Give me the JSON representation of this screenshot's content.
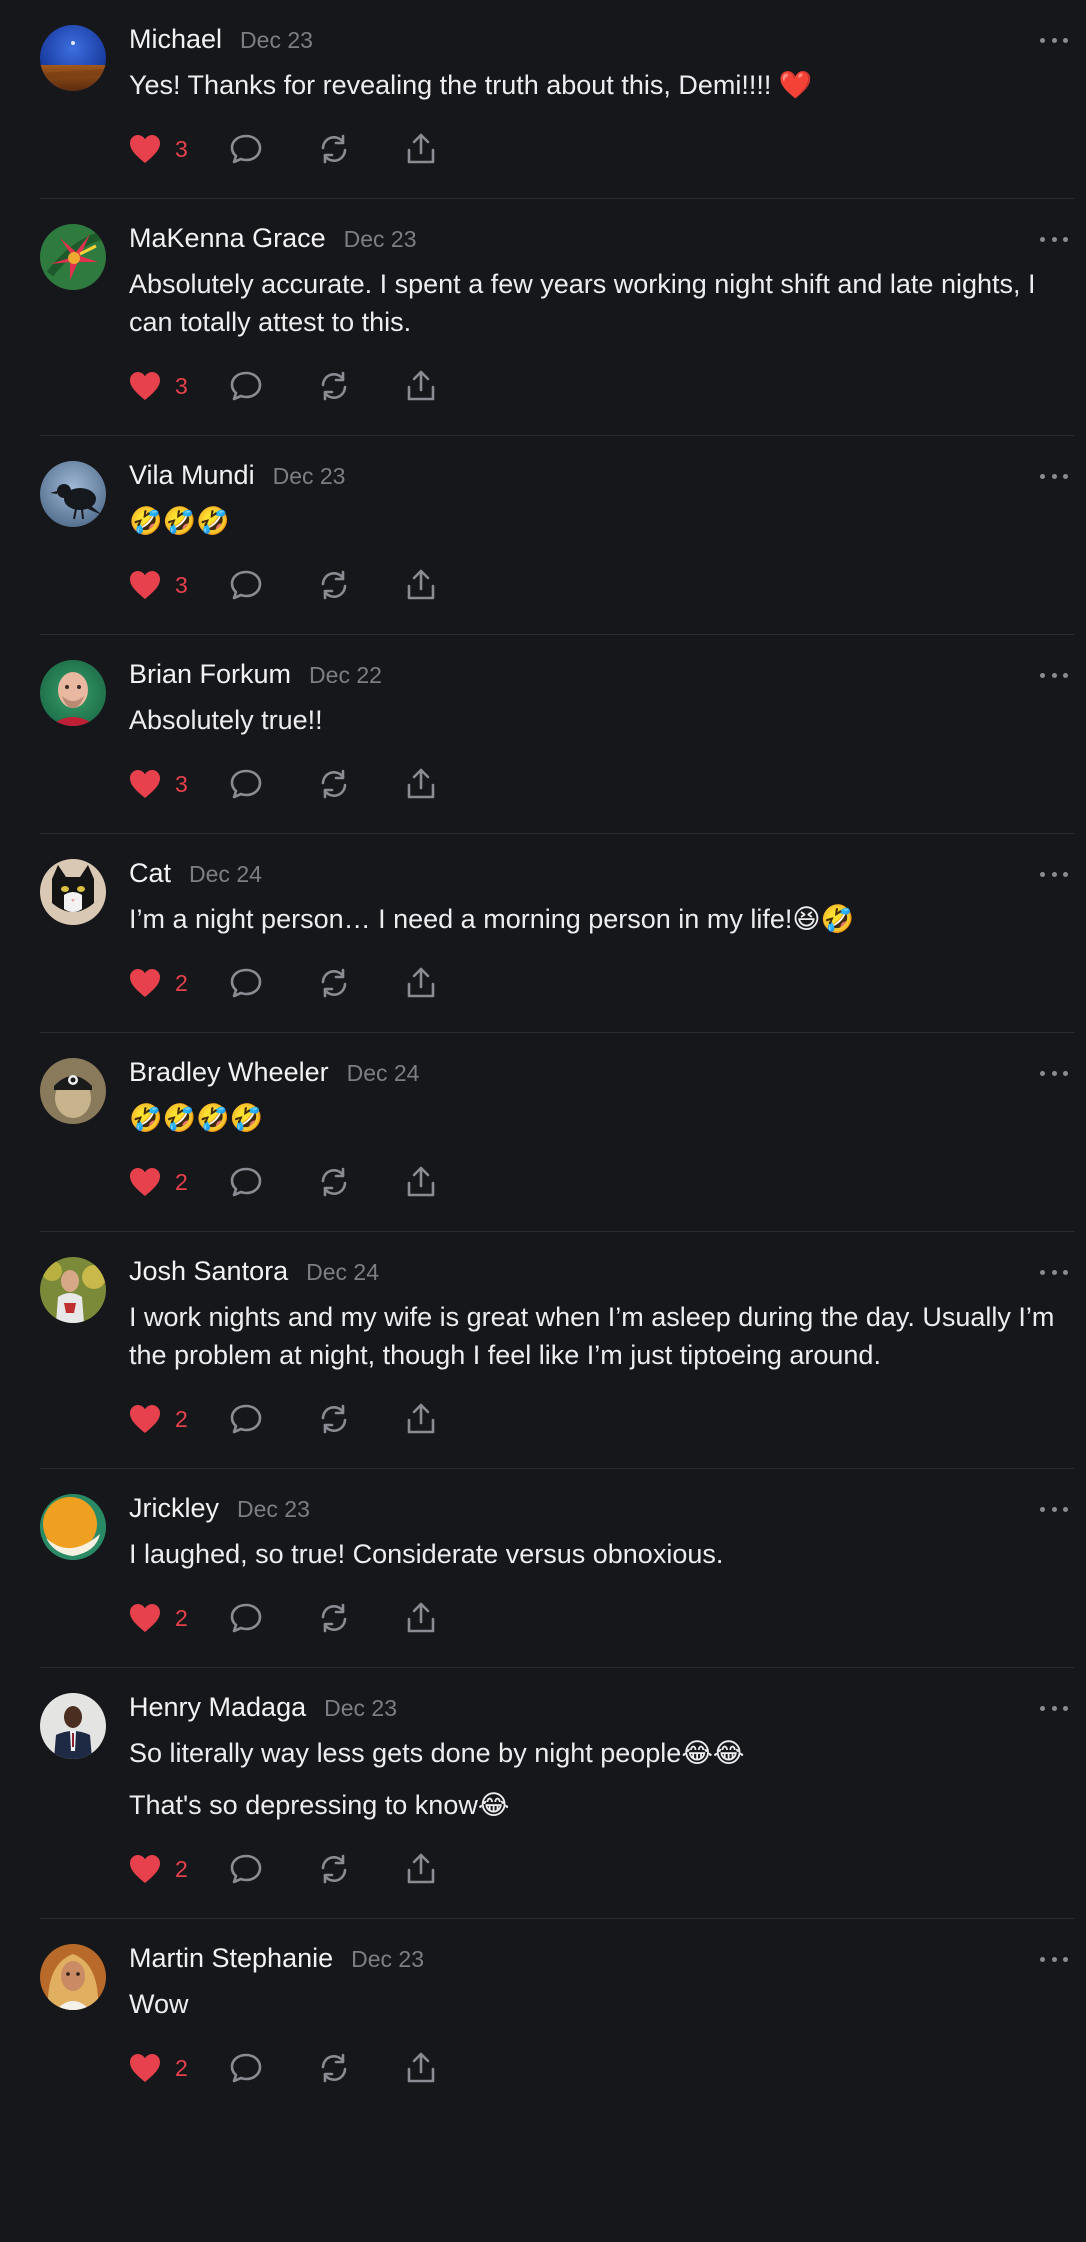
{
  "comments": [
    {
      "author": "Michael",
      "date": "Dec 23",
      "lines": [
        "Yes! Thanks for revealing the truth about this, Demi!!!! ❤️"
      ],
      "likes": "3",
      "avatar": "blue-sky-landscape"
    },
    {
      "author": "MaKenna Grace",
      "date": "Dec 23",
      "lines": [
        "Absolutely accurate. I spent a few years working night shift and late nights, I can totally attest to this."
      ],
      "likes": "3",
      "avatar": "tropical-flower"
    },
    {
      "author": "Vila Mundi",
      "date": "Dec 23",
      "lines": [
        "🤣🤣🤣"
      ],
      "likes": "3",
      "avatar": "crow-sky"
    },
    {
      "author": "Brian Forkum",
      "date": "Dec 22",
      "lines": [
        "Absolutely true!!"
      ],
      "likes": "3",
      "avatar": "man-portrait-green"
    },
    {
      "author": "Cat",
      "date": "Dec 24",
      "lines": [
        "I’m a night person… I need a morning person in my life!😆🤣"
      ],
      "likes": "2",
      "avatar": "black-white-cat"
    },
    {
      "author": "Bradley Wheeler",
      "date": "Dec 24",
      "lines": [
        "🤣🤣🤣🤣"
      ],
      "likes": "2",
      "avatar": "person-in-cap"
    },
    {
      "author": "Josh Santora",
      "date": "Dec 24",
      "lines": [
        "I work nights and my wife is great when I’m asleep during the day. Usually I’m the problem at night, though I feel like I’m just tiptoeing around."
      ],
      "likes": "2",
      "avatar": "person-outdoors"
    },
    {
      "author": "Jrickley",
      "date": "Dec 23",
      "lines": [
        "I laughed, so true! Considerate versus obnoxious."
      ],
      "likes": "2",
      "avatar": "orange-circle-logo"
    },
    {
      "author": "Henry Madaga",
      "date": "Dec 23",
      "lines": [
        "So literally way less gets done by night people😂😂",
        "That's so depressing to know😂"
      ],
      "likes": "2",
      "avatar": "man-in-suit"
    },
    {
      "author": "Martin Stephanie",
      "date": "Dec 23",
      "lines": [
        "Wow"
      ],
      "likes": "2",
      "avatar": "woman-portrait"
    }
  ],
  "icons": {
    "like": "heart-icon",
    "reply": "comment-bubble-icon",
    "repost": "repost-arrows-icon",
    "share": "share-upload-icon",
    "more": "more-dots-icon"
  },
  "colors": {
    "background": "#16171a",
    "like_accent": "#e6414c",
    "muted": "#7c7e85",
    "text": "#ededf0"
  }
}
